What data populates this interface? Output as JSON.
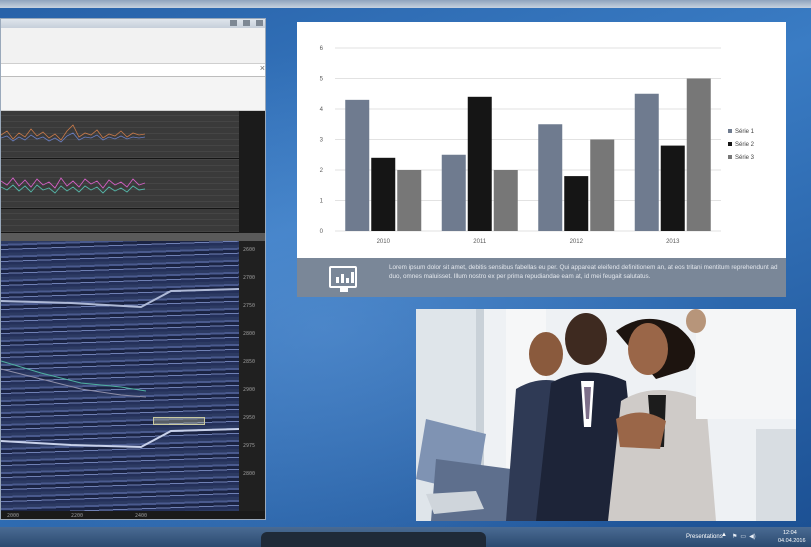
{
  "chart_data": {
    "type": "bar",
    "categories": [
      "2010",
      "2011",
      "2012",
      "2013"
    ],
    "series": [
      {
        "name": "Série 1",
        "color": "#6f7b8f",
        "values": [
          4.3,
          2.5,
          3.5,
          4.5
        ]
      },
      {
        "name": "Série 2",
        "color": "#151515",
        "values": [
          2.4,
          4.4,
          1.8,
          2.8
        ]
      },
      {
        "name": "Série 3",
        "color": "#777777",
        "values": [
          2,
          2,
          3,
          5
        ]
      }
    ],
    "y_ticks": [
      "0",
      "1",
      "2",
      "3",
      "4",
      "5",
      "6"
    ],
    "ylim": [
      0,
      6
    ],
    "legend_position": "right",
    "grid": true
  },
  "slide_footer": {
    "icon": "presentation-chart-icon",
    "text": "Lorem ipsum dolor sit amet, debitis sensibus fabellas eu per. Qui appareat eleifend definitionem an, at eos tritani mentitum reprehendunt ad duo, omnes maluisset. Illum nostro ex per prima repudiandae eam at, id mei feugait salutatus."
  },
  "seismic_window": {
    "y_axis_labels": [
      "2600",
      "2700",
      "2750",
      "2800",
      "2850",
      "2900",
      "2950",
      "2975",
      "2800"
    ],
    "x_axis_labels": [
      "2000",
      "2200",
      "2400"
    ]
  },
  "taskbar": {
    "active_app": "Presentations",
    "time": "12:04",
    "date": "04.04.2016",
    "tray_icons": [
      "flag-icon",
      "network-icon",
      "volume-icon"
    ]
  }
}
